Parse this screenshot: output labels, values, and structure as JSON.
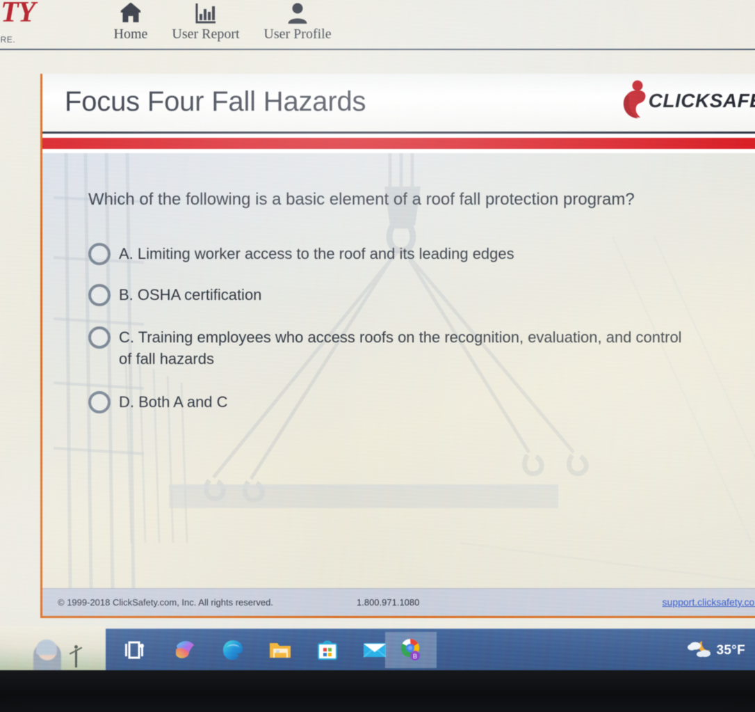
{
  "nav": {
    "brand": {
      "word": "ETY",
      "tagline": "UTURE."
    },
    "items": [
      {
        "id": "home",
        "label": "Home",
        "icon": "home-icon"
      },
      {
        "id": "report",
        "label": "User Report",
        "icon": "bar-chart-icon"
      },
      {
        "id": "profile",
        "label": "User Profile",
        "icon": "user-icon"
      }
    ]
  },
  "course": {
    "title": "Focus Four Fall Hazards",
    "logo_text": "CLICKSAFET",
    "accent_red": "#d81f26",
    "accent_orange": "#d9691e",
    "header_rule": "#2c3242"
  },
  "quiz": {
    "question": "Which of the following is a basic element of a roof fall protection program?",
    "options": [
      {
        "id": "a",
        "label": "A. Limiting worker access to the roof and its leading edges",
        "selected": false
      },
      {
        "id": "b",
        "label": "B. OSHA certification",
        "selected": false
      },
      {
        "id": "c",
        "label": "C. Training employees who access roofs on the recognition, evaluation, and control of fall hazards",
        "selected": false
      },
      {
        "id": "d",
        "label": "D. Both A and C",
        "selected": false
      }
    ]
  },
  "footer": {
    "copyright": "© 1999-2018 ClickSafety.com, Inc.  All rights reserved.",
    "phone": "1.800.971.1080",
    "support_link": "support.clicksafety.com",
    "link_color": "#2d54c8"
  },
  "taskbar": {
    "items": [
      {
        "id": "taskview",
        "name": "task-view-icon",
        "active": false
      },
      {
        "id": "copilot",
        "name": "copilot-icon",
        "active": false
      },
      {
        "id": "edge",
        "name": "edge-browser-icon",
        "active": false
      },
      {
        "id": "files",
        "name": "file-explorer-icon",
        "active": false
      },
      {
        "id": "store",
        "name": "microsoft-store-icon",
        "active": false
      },
      {
        "id": "mail",
        "name": "mail-icon",
        "active": false
      },
      {
        "id": "chrome",
        "name": "chrome-browser-icon",
        "active": true
      }
    ],
    "weather": {
      "temperature": "35°F",
      "icon": "partly-cloudy-night-icon"
    },
    "background_color": "#3f5e91"
  }
}
